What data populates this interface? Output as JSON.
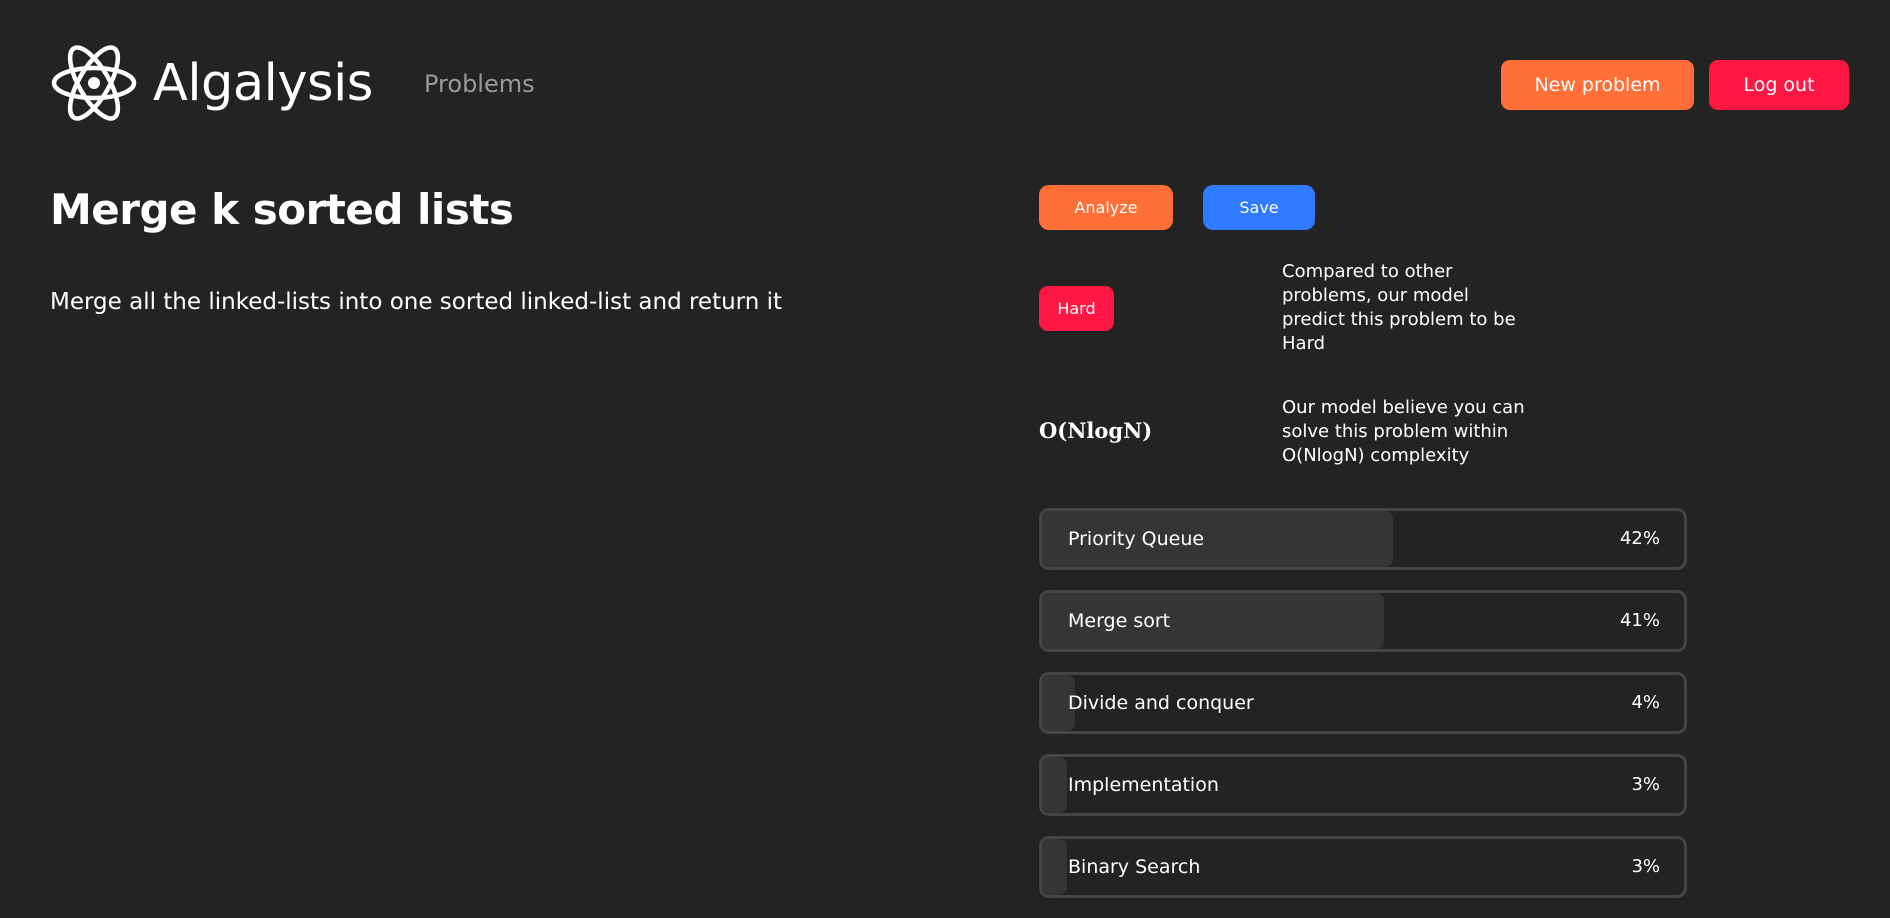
{
  "header": {
    "brand": "Algalysis",
    "nav_problems": "Problems",
    "new_problem_label": "New problem",
    "logout_label": "Log out"
  },
  "problem": {
    "title": "Merge k sorted lists",
    "description": "Merge all the linked-lists into one sorted linked-list and return it"
  },
  "actions": {
    "analyze_label": "Analyze",
    "save_label": "Save"
  },
  "analysis": {
    "difficulty": "Hard",
    "difficulty_note": "Compared to other problems, our model predict this problem to be Hard",
    "complexity": "O(NlogN)",
    "complexity_note": "Our model believe you can solve this problem within O(NlogN) complexity"
  },
  "topics": [
    {
      "label": "Priority Queue",
      "percent": "42%",
      "value": 42
    },
    {
      "label": "Merge sort",
      "percent": "41%",
      "value": 41
    },
    {
      "label": "Divide and conquer",
      "percent": "4%",
      "value": 4
    },
    {
      "label": "Implementation",
      "percent": "3%",
      "value": 3
    },
    {
      "label": "Binary Search",
      "percent": "3%",
      "value": 3
    }
  ],
  "colors": {
    "background": "#232323",
    "orange": "#ff6f37",
    "red": "#ff1744",
    "blue": "#2f7aff",
    "nav_gray": "#9a9a9a"
  },
  "icons": {
    "logo": "atom-icon"
  }
}
